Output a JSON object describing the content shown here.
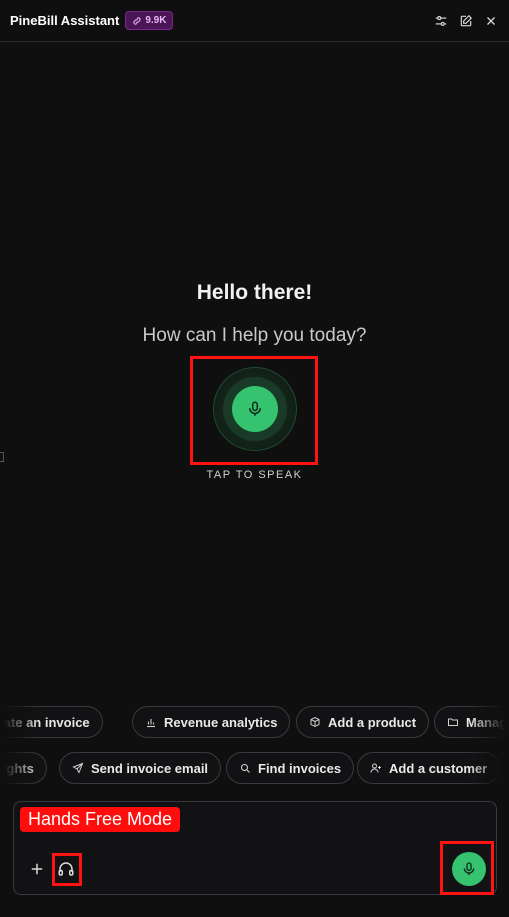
{
  "header": {
    "title": "PineBill Assistant",
    "badge": "9.9K",
    "icons": [
      "settings-sliders-icon",
      "edit-icon",
      "close-icon"
    ]
  },
  "welcome": {
    "greeting": "Hello there!",
    "prompt": "How can I help you today?",
    "tap_label": "TAP TO SPEAK"
  },
  "suggestions": {
    "row1": [
      {
        "label": "Create an invoice",
        "icon": "file-icon"
      },
      {
        "label": "Revenue analytics",
        "icon": "bar-chart-icon"
      },
      {
        "label": "Add a product",
        "icon": "box-icon"
      },
      {
        "label": "Manage",
        "icon": "folder-icon"
      }
    ],
    "row2": [
      {
        "label": "Insights",
        "icon": "sparkle-icon"
      },
      {
        "label": "Send invoice email",
        "icon": "send-icon"
      },
      {
        "label": "Find invoices",
        "icon": "search-icon"
      },
      {
        "label": "Add a customer",
        "icon": "user-plus-icon"
      }
    ]
  },
  "composer": {
    "mode_label": "Hands Free Mode"
  },
  "colors": {
    "background": "#0f0f10",
    "accent_green": "#35c36f",
    "badge_purple": "#4a1656",
    "highlight_red": "#ff1212"
  }
}
